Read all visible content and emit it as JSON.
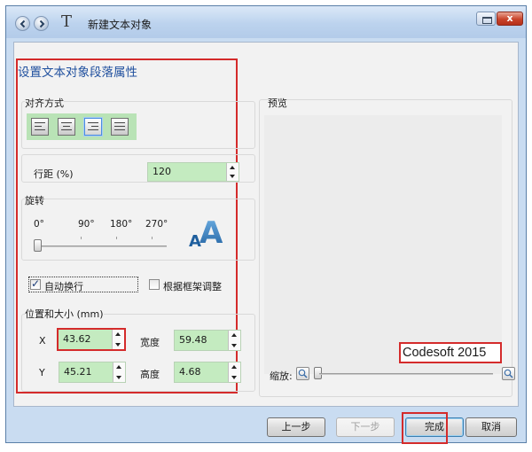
{
  "window": {
    "title": "新建文本对象",
    "app_icon": "T-text-icon",
    "close_glyph": "x"
  },
  "page": {
    "heading": "设置文本对象段落属性"
  },
  "alignment": {
    "label": "对齐方式",
    "buttons": [
      {
        "name": "align-left",
        "icon": "align-left-icon",
        "active": false
      },
      {
        "name": "align-center",
        "icon": "align-center-icon",
        "active": false
      },
      {
        "name": "align-right",
        "icon": "align-right-icon",
        "active": true
      },
      {
        "name": "align-justify",
        "icon": "align-justify-icon",
        "active": false
      }
    ]
  },
  "line_spacing": {
    "label": "行距 (%)",
    "value": "120"
  },
  "rotation": {
    "label": "旋转",
    "angles": [
      "0°",
      "90°",
      "180°",
      "270°"
    ],
    "value_degrees": 0,
    "preview_glyph": "A"
  },
  "options": {
    "wrap": {
      "label": "自动换行",
      "checked": true
    },
    "fit_frame": {
      "label": "根据框架调整",
      "checked": false
    }
  },
  "position_size": {
    "label": "位置和大小 (mm)",
    "x": {
      "label": "X",
      "value": "43.62"
    },
    "y": {
      "label": "Y",
      "value": "45.21"
    },
    "width": {
      "label": "宽度",
      "value": "59.48"
    },
    "height": {
      "label": "高度",
      "value": "4.68"
    }
  },
  "preview": {
    "label": "预览",
    "sample_text": "Codesoft 2015",
    "zoom_label": "缩放:"
  },
  "buttons": {
    "back": "上一步",
    "next": "下一步",
    "finish": "完成",
    "cancel": "取消"
  },
  "colors": {
    "title_accent": "#1f4f9e",
    "highlight_red": "#d42b2b",
    "field_green": "#c4ebc0"
  }
}
